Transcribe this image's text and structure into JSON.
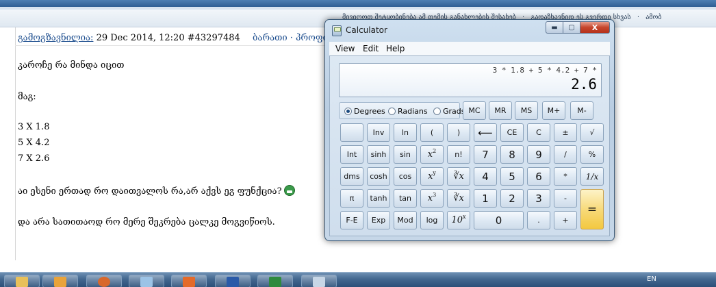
{
  "page": {
    "nav_links": [
      "მივიღოთ შეტყობინება ამ თემის განახლების შესახებ",
      "·",
      "გადაზხავნიდ ეს გვერდი სხვას",
      "·",
      "ამობ"
    ],
    "post": {
      "author": "გამოგზავნილია:",
      "date": "29 Dec 2014, 12:20",
      "post_id": "#43297484",
      "links": "ბარათი · პროფილი",
      "lines": [
        "კაროჩე რა მინდა იცით",
        "მაგ:",
        "3 X 1.8",
        "5 X 4.2",
        "7 X 2.6",
        "აი ესენი ერთად რო დაითვალოს რა,არ აქვს ეგ ფუნქცია?",
        "და არა სათითაოდ რო მერე შეკრება ცალკე მოგვიწიოს."
      ]
    }
  },
  "calculator": {
    "title": "Calculator",
    "window_buttons": {
      "minimize": "▬",
      "maximize": "▢",
      "close": "X"
    },
    "menu": [
      "View",
      "Edit",
      "Help"
    ],
    "expression": "3 * 1.8 + 5 * 4.2 + 7 *",
    "result": "2.6",
    "angle_modes": [
      "Degrees",
      "Radians",
      "Grads"
    ],
    "selected_angle": "Degrees",
    "buttons": {
      "mc": "MC",
      "mr": "MR",
      "ms": "MS",
      "mplus": "M+",
      "mminus": "M-",
      "inv": "Inv",
      "ln": "ln",
      "lparen": "(",
      "rparen": ")",
      "backspace": "⟵",
      "ce": "CE",
      "c": "C",
      "plusminus": "±",
      "sqrt": "√",
      "int": "Int",
      "sinh": "sinh",
      "sin": "sin",
      "x2_base": "x",
      "x2_exp": "2",
      "fact": "n!",
      "d7": "7",
      "d8": "8",
      "d9": "9",
      "div": "/",
      "pct": "%",
      "dms": "dms",
      "cosh": "cosh",
      "cos": "cos",
      "xy_base": "x",
      "xy_exp": "y",
      "yroot": "∛x",
      "d4": "4",
      "d5": "5",
      "d6": "6",
      "mul": "*",
      "recip": "1/x",
      "pi": "π",
      "tanh": "tanh",
      "tan": "tan",
      "x3_base": "x",
      "x3_exp": "3",
      "cuberoot": "∛x",
      "d1": "1",
      "d2": "2",
      "d3": "3",
      "sub": "-",
      "eq": "=",
      "fe": "F-E",
      "exp": "Exp",
      "mod": "Mod",
      "log": "log",
      "tenx_base": "10",
      "tenx_exp": "x",
      "d0": "0",
      "dot": ".",
      "add": "+"
    }
  },
  "taskbar": {
    "language": "EN",
    "apps": [
      "folder-icon",
      "outlook-icon",
      "firefox-icon",
      "document-icon",
      "app-icon",
      "word-icon",
      "excel-icon",
      "calculator-icon"
    ]
  },
  "colors": {
    "page_bg": "#ffffff",
    "link": "#1c4d8e",
    "equals_button": "#f7d874",
    "window_frame": "#b9cde2"
  }
}
